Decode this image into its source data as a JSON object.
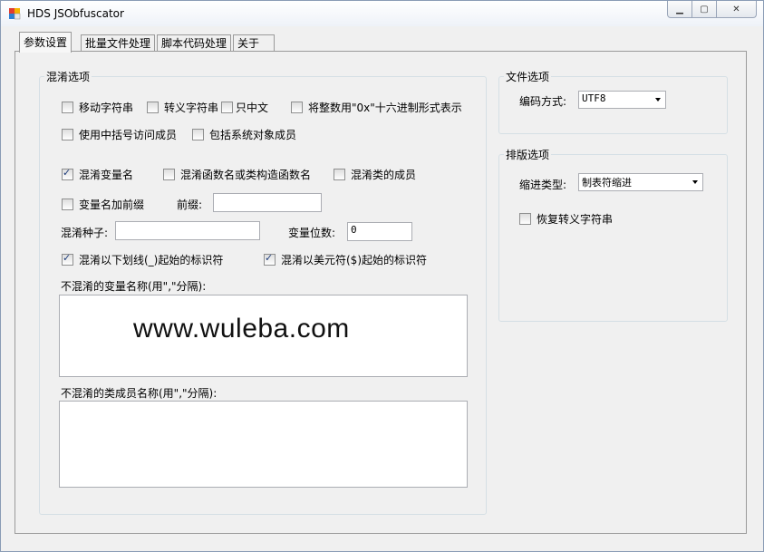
{
  "window": {
    "title": "HDS JSObfuscator"
  },
  "tabs": [
    {
      "label": "参数设置"
    },
    {
      "label": "批量文件处理"
    },
    {
      "label": "脚本代码处理"
    },
    {
      "label": "关于"
    }
  ],
  "obfuscation": {
    "group_title": "混淆选项",
    "checkboxes": {
      "move_strings": {
        "label": "移动字符串",
        "checked": false
      },
      "escape_strings": {
        "label": "转义字符串",
        "checked": false
      },
      "chinese_only": {
        "label": "只中文",
        "checked": false
      },
      "hex_integers": {
        "label": "将整数用\"0x\"十六进制形式表示",
        "checked": false
      },
      "bracket_access": {
        "label": "使用中括号访问成员",
        "checked": false
      },
      "system_members": {
        "label": "包括系统对象成员",
        "checked": false
      },
      "obfuscate_vars": {
        "label": "混淆变量名",
        "checked": true
      },
      "obfuscate_funcs": {
        "label": "混淆函数名或类构造函数名",
        "checked": false
      },
      "obfuscate_class_members": {
        "label": "混淆类的成员",
        "checked": false
      },
      "var_prefix": {
        "label": "变量名加前缀",
        "checked": false
      },
      "underscore_ids": {
        "label": "混淆以下划线(_)起始的标识符",
        "checked": true
      },
      "dollar_ids": {
        "label": "混淆以美元符($)起始的标识符",
        "checked": true
      }
    },
    "prefix_label": "前缀:",
    "prefix_value": "",
    "seed_label": "混淆种子:",
    "seed_value": "",
    "digits_label": "变量位数:",
    "digits_value": "0",
    "excluded_vars_label": "不混淆的变量名称(用\",\"分隔):",
    "excluded_members_label": "不混淆的类成员名称(用\",\"分隔):",
    "watermark": "www.wuleba.com"
  },
  "file_options": {
    "group_title": "文件选项",
    "encoding_label": "编码方式:",
    "encoding_value": "UTF8"
  },
  "layout_options": {
    "group_title": "排版选项",
    "indent_label": "缩进类型:",
    "indent_value": "制表符缩进",
    "restore_escape": {
      "label": "恢复转义字符串",
      "checked": false
    }
  }
}
